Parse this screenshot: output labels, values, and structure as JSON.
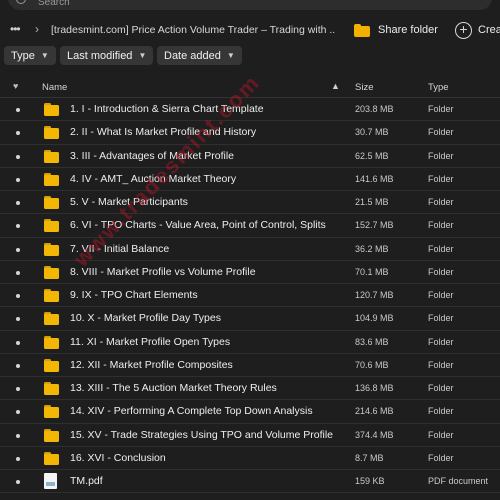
{
  "search": {
    "placeholder": "Search"
  },
  "path": {
    "title": "[tradesmint.com] Price Action Volume Trader – Trading with ..."
  },
  "actions": {
    "share": "Share folder",
    "create": "Create"
  },
  "filters": [
    "Type",
    "Last modified",
    "Date added"
  ],
  "columns": {
    "name": "Name",
    "size": "Size",
    "type": "Type"
  },
  "rows": [
    {
      "name": "1. I - Introduction & Sierra Chart Template",
      "size": "203.8 MB",
      "type": "Folder",
      "icon": "folder-icon"
    },
    {
      "name": "2. II - What Is Market Profile and History",
      "size": "30.7 MB",
      "type": "Folder",
      "icon": "folder-icon"
    },
    {
      "name": "3. III - Advantages of Market Profile",
      "size": "62.5 MB",
      "type": "Folder",
      "icon": "folder-icon"
    },
    {
      "name": "4. IV - AMT_ Auction Market Theory",
      "size": "141.6 MB",
      "type": "Folder",
      "icon": "folder-icon"
    },
    {
      "name": "5. V - Market Participants",
      "size": "21.5 MB",
      "type": "Folder",
      "icon": "folder-icon"
    },
    {
      "name": "6. VI - TPO Charts - Value Area, Point of Control, Splits",
      "size": "152.7 MB",
      "type": "Folder",
      "icon": "folder-icon"
    },
    {
      "name": "7. VII - Initial Balance",
      "size": "36.2 MB",
      "type": "Folder",
      "icon": "folder-icon"
    },
    {
      "name": "8. VIII - Market Profile vs Volume Profile",
      "size": "70.1 MB",
      "type": "Folder",
      "icon": "folder-icon"
    },
    {
      "name": "9. IX - TPO Chart Elements",
      "size": "120.7 MB",
      "type": "Folder",
      "icon": "folder-icon"
    },
    {
      "name": "10. X - Market Profile Day Types",
      "size": "104.9 MB",
      "type": "Folder",
      "icon": "folder-icon"
    },
    {
      "name": "11. XI - Market Profile Open Types",
      "size": "83.6 MB",
      "type": "Folder",
      "icon": "folder-icon"
    },
    {
      "name": "12. XII - Market Profile Composites",
      "size": "70.6 MB",
      "type": "Folder",
      "icon": "folder-icon"
    },
    {
      "name": "13. XIII - The 5 Auction Market Theory Rules",
      "size": "136.8 MB",
      "type": "Folder",
      "icon": "folder-icon"
    },
    {
      "name": "14. XIV - Performing A Complete Top Down Analysis",
      "size": "214.6 MB",
      "type": "Folder",
      "icon": "folder-icon"
    },
    {
      "name": "15. XV - Trade Strategies Using TPO and Volume Profile",
      "size": "374.4 MB",
      "type": "Folder",
      "icon": "folder-icon"
    },
    {
      "name": "16. XVI - Conclusion",
      "size": "8.7 MB",
      "type": "Folder",
      "icon": "folder-icon"
    },
    {
      "name": "TM.pdf",
      "size": "159 KB",
      "type": "PDF document",
      "icon": "pdf-file-icon"
    }
  ],
  "watermark": "www.tradesmint.com",
  "colors": {
    "background": "#1e1e1e",
    "folder": "#f2b705",
    "watermark": "#c81428"
  }
}
